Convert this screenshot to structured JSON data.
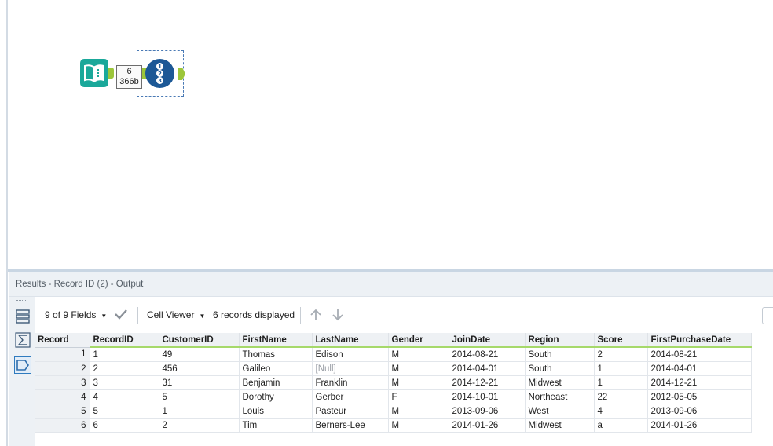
{
  "canvas": {
    "badge_count": "6",
    "badge_size": "366b"
  },
  "results": {
    "title": "Results - Record ID (2) - Output"
  },
  "toolbar": {
    "fields_label": "9 of 9 Fields",
    "viewer_label": "Cell Viewer",
    "records_label": "6 records displayed"
  },
  "grid": {
    "columns": [
      "Record",
      "RecordID",
      "CustomerID",
      "FirstName",
      "LastName",
      "Gender",
      "JoinDate",
      "Region",
      "Score",
      "FirstPurchaseDate"
    ],
    "rows": [
      [
        "1",
        "1",
        "49",
        "Thomas",
        "Edison",
        "M",
        "2014-08-21",
        "South",
        "2",
        "2014-08-21"
      ],
      [
        "2",
        "2",
        "456",
        "Galileo",
        "[Null]",
        "M",
        "2014-04-01",
        "South",
        "1",
        "2014-04-01"
      ],
      [
        "3",
        "3",
        "31",
        "Benjamin",
        "Franklin",
        "M",
        "2014-12-21",
        "Midwest",
        "1",
        "2014-12-21"
      ],
      [
        "4",
        "4",
        "5",
        "Dorothy",
        "Gerber",
        "F",
        "2014-10-01",
        "Northeast",
        "22",
        "2012-05-05"
      ],
      [
        "5",
        "5",
        "1",
        "Louis",
        "Pasteur",
        "M",
        "2013-09-06",
        "West",
        "4",
        "2013-09-06"
      ],
      [
        "6",
        "6",
        "2",
        "Tim",
        "Berners-Lee",
        "M",
        "2014-01-26",
        "Midwest",
        "a",
        "2014-01-26"
      ]
    ]
  },
  "colors": {
    "input_tool": "#1aa89a",
    "recordid_tool": "#1c5896",
    "connector": "#9cc63a",
    "header_underline": "#a6d96a"
  }
}
